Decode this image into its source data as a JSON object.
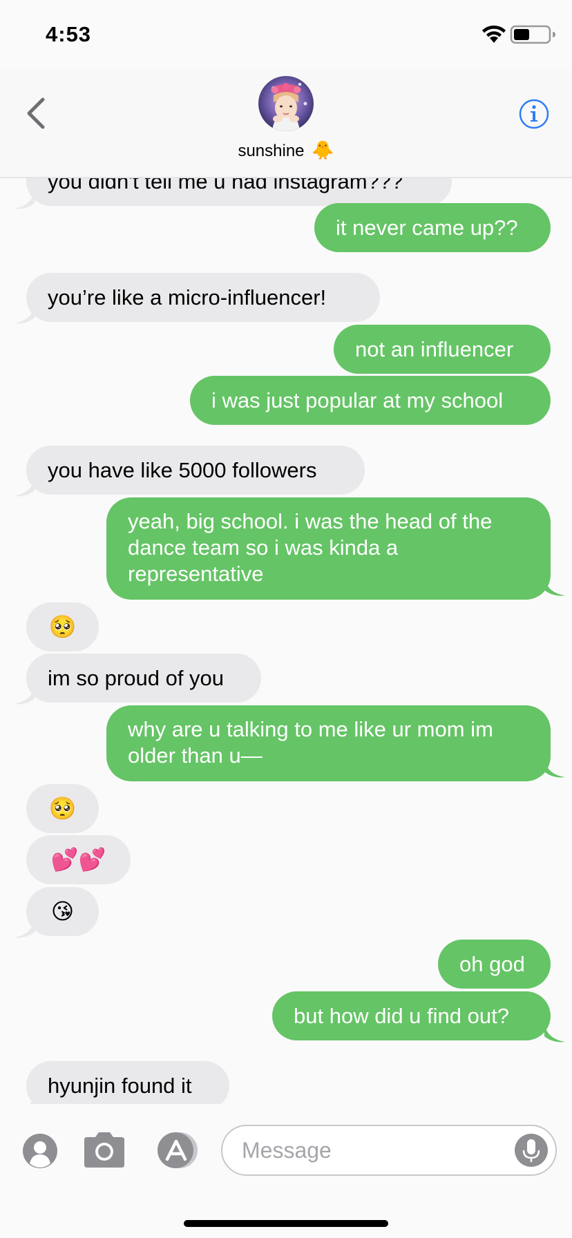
{
  "status_bar": {
    "time": "4:53"
  },
  "header": {
    "contact_name": "sunshine",
    "contact_emoji": "🐥"
  },
  "messages": [
    {
      "side": "in",
      "text": "you didn't tell me u had instagram???"
    },
    {
      "side": "out",
      "text": "it never came up??"
    },
    {
      "side": "in",
      "text": "you’re like a micro-influencer!"
    },
    {
      "side": "out",
      "text": "not an influencer"
    },
    {
      "side": "out",
      "text": "i was just popular at my school"
    },
    {
      "side": "in",
      "text": "you have like 5000 followers"
    },
    {
      "side": "out",
      "text": "yeah, big school. i was the head of the dance team so i was kinda a representative"
    },
    {
      "side": "in",
      "text": "🥺"
    },
    {
      "side": "in",
      "text": "im so proud of you"
    },
    {
      "side": "out",
      "text": "why are u talking to me like ur mom im older than u—"
    },
    {
      "side": "in",
      "text": "🥺"
    },
    {
      "side": "in",
      "text": "💕💕"
    },
    {
      "side": "in",
      "text": "😘"
    },
    {
      "side": "out",
      "text": "oh god"
    },
    {
      "side": "out",
      "text": "but how did u find out?"
    },
    {
      "side": "in",
      "text": "hyunjin found it"
    }
  ],
  "input": {
    "placeholder": "Message",
    "value": ""
  },
  "colors": {
    "outgoing_bubble": "#65c466",
    "incoming_bubble": "#e9e9eb",
    "accent": "#2f7cf6"
  }
}
